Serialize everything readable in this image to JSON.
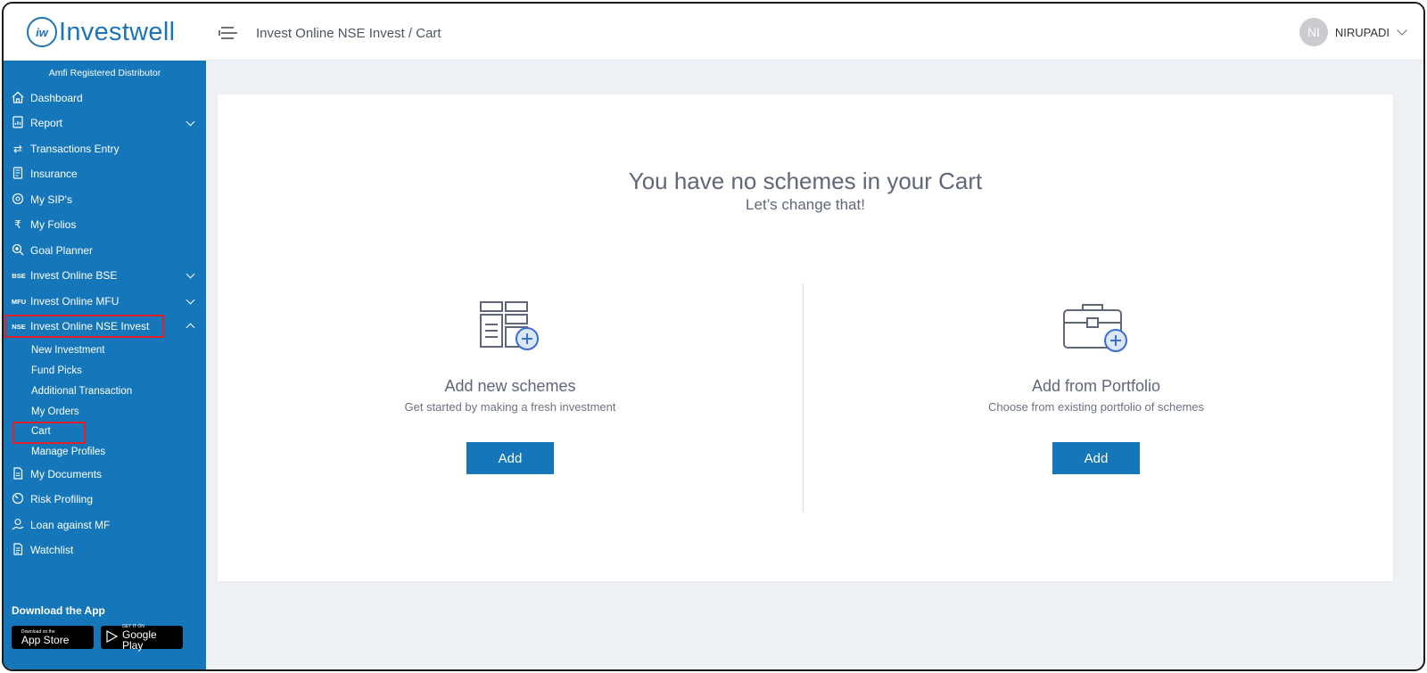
{
  "header": {
    "logo_mark": "iw",
    "logo_text": "Investwell",
    "breadcrumb": "Invest Online NSE Invest / Cart",
    "user_initials": "NI",
    "user_name": "NIRUPADI"
  },
  "sidebar": {
    "tagline": "Amfi Registered Distributor",
    "items": [
      {
        "label": "Dashboard"
      },
      {
        "label": "Report"
      },
      {
        "label": "Transactions Entry"
      },
      {
        "label": "Insurance"
      },
      {
        "label": "My SIP's"
      },
      {
        "label": "My Folios"
      },
      {
        "label": "Goal Planner"
      },
      {
        "label": "Invest Online BSE",
        "tag": "BSE"
      },
      {
        "label": "Invest Online MFU",
        "tag": "MFU"
      },
      {
        "label": "Invest Online NSE Invest",
        "tag": "NSE"
      },
      {
        "label": "My Documents"
      },
      {
        "label": "Risk Profiling"
      },
      {
        "label": "Loan against MF"
      },
      {
        "label": "Watchlist"
      }
    ],
    "subitems": [
      {
        "label": "New Investment"
      },
      {
        "label": "Fund Picks"
      },
      {
        "label": "Additional Transaction"
      },
      {
        "label": "My Orders"
      },
      {
        "label": "Cart"
      },
      {
        "label": "Manage Profiles"
      }
    ],
    "download_title": "Download the App",
    "app_store": {
      "small": "Download on the",
      "big": "App Store"
    },
    "google_play": {
      "small": "GET IT ON",
      "big": "Google Play"
    }
  },
  "main": {
    "empty_title": "You have no schemes in your Cart",
    "empty_subtitle": "Let’s change that!",
    "options": [
      {
        "title": "Add new schemes",
        "desc": "Get started by making a fresh investment",
        "button": "Add"
      },
      {
        "title": "Add from Portfolio",
        "desc": "Choose from existing portfolio of schemes",
        "button": "Add"
      }
    ]
  },
  "colors": {
    "brand": "#1577b9",
    "highlight": "#e0202a",
    "text_muted": "#5f6778"
  }
}
